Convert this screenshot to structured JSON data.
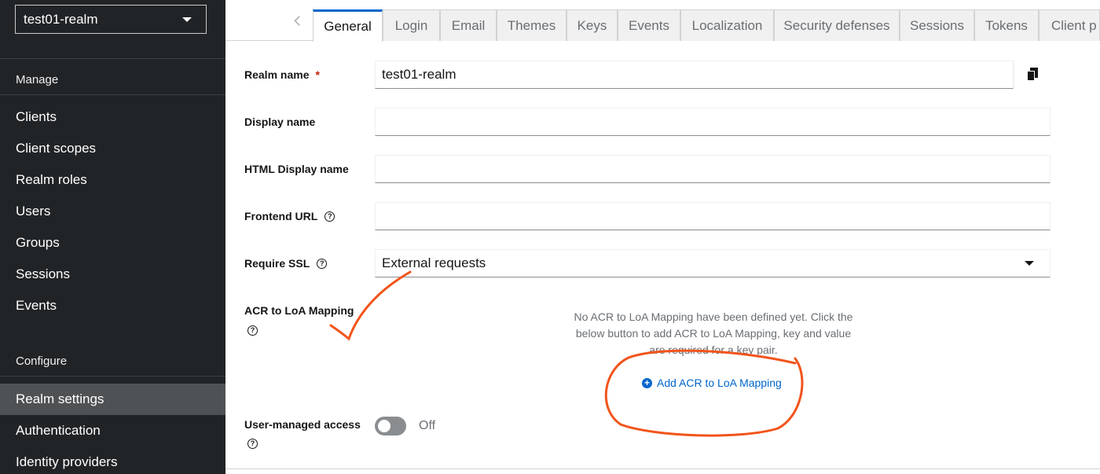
{
  "sidebar": {
    "realm_select": "test01-realm",
    "manage_heading": "Manage",
    "manage_items": [
      "Clients",
      "Client scopes",
      "Realm roles",
      "Users",
      "Groups",
      "Sessions",
      "Events"
    ],
    "configure_heading": "Configure",
    "configure_items": [
      "Realm settings",
      "Authentication",
      "Identity providers"
    ],
    "active_item": "Realm settings"
  },
  "tabs": [
    "General",
    "Login",
    "Email",
    "Themes",
    "Keys",
    "Events",
    "Localization",
    "Security defenses",
    "Sessions",
    "Tokens",
    "Client p"
  ],
  "active_tab": "General",
  "form": {
    "realm_name_label": "Realm name",
    "required_marker": "*",
    "realm_name_value": "test01-realm",
    "display_name_label": "Display name",
    "display_name_value": "",
    "html_display_name_label": "HTML Display name",
    "html_display_name_value": "",
    "frontend_url_label": "Frontend URL",
    "frontend_url_value": "",
    "require_ssl_label": "Require SSL",
    "require_ssl_value": "External requests",
    "acr_label": "ACR to LoA Mapping",
    "acr_empty_text": "No ACR to LoA Mapping have been defined yet. Click the below button to add ACR to LoA Mapping, key and value are required for a key pair.",
    "acr_add_link": "Add ACR to LoA Mapping",
    "user_managed_label": "User-managed access",
    "user_managed_state": "Off"
  },
  "help_glyph": "?",
  "colors": {
    "sidebar_bg": "#212427",
    "sidebar_active": "#4f5255",
    "link_blue": "#0066cc",
    "annotation_orange": "#f2541b"
  }
}
